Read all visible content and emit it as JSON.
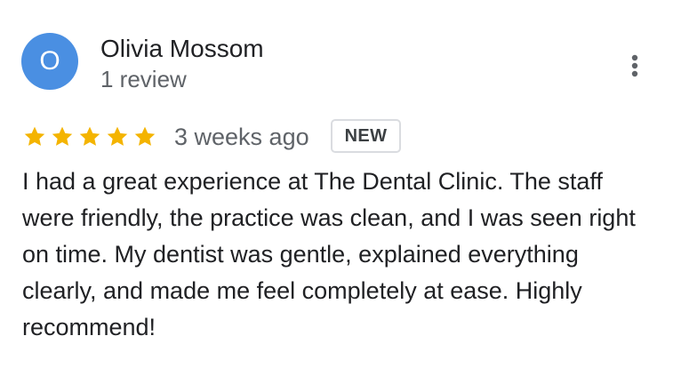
{
  "review": {
    "avatar_initial": "O",
    "reviewer_name": "Olivia Mossom",
    "reviewer_meta": "1 review",
    "rating": 5,
    "time_ago": "3 weeks ago",
    "badge": "NEW",
    "text": "I had a great experience at The Dental Clinic. The staff were friendly, the practice was clean, and I was seen right on time. My dentist was gentle, explained everything clearly, and made me feel completely at ease. Highly recommend!"
  },
  "icons": {
    "menu": "more-vertical-icon",
    "star": "star-icon"
  },
  "colors": {
    "avatar_background": "#4a8fe2",
    "star": "#f4b400",
    "secondary_text": "#5f6368",
    "badge_border": "#dadce0"
  }
}
